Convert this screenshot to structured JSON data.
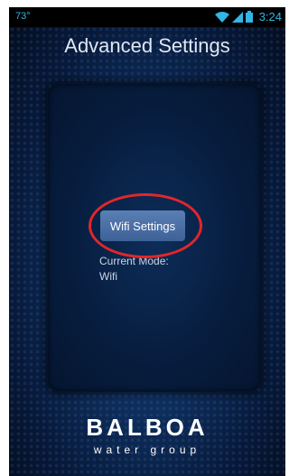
{
  "status_bar": {
    "temperature": "73°",
    "time": "3:24"
  },
  "screen": {
    "title": "Advanced Settings"
  },
  "wifi_button": {
    "label": "Wifi Settings"
  },
  "mode": {
    "label": "Current Mode:",
    "value": "Wifi"
  },
  "logo": {
    "brand": "BALBOA",
    "subtitle": "water group"
  },
  "colors": {
    "accent_status": "#33b5e5",
    "highlight_ring": "#e3262b",
    "button": "#4a6ea6"
  }
}
